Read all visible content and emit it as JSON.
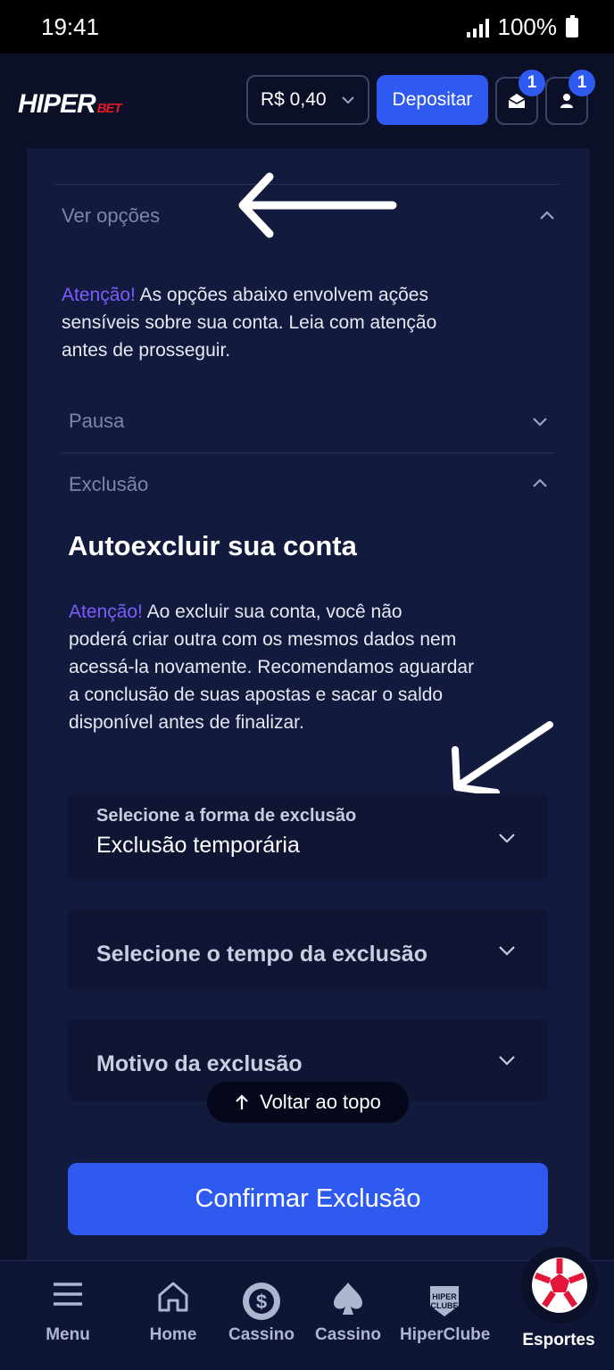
{
  "status_bar": {
    "time": "19:41",
    "battery": "100%"
  },
  "header": {
    "logo_main": "HIPER",
    "logo_sub": "BET",
    "balance": "R$ 0,40",
    "deposit_label": "Depositar",
    "messages_badge": "1",
    "profile_badge": "1"
  },
  "options": {
    "ver_opcoes": "Ver opções",
    "warning_prefix": "Atenção!",
    "warning_lines": [
      "As opções abaixo envolvem ações",
      "sensíveis sobre sua conta. Leia com atenção",
      "antes de prosseguir."
    ],
    "pausa": "Pausa",
    "exclusao": "Exclusão"
  },
  "exclusion": {
    "title": "Autoexcluir sua conta",
    "warning_prefix": "Atenção!",
    "warning_lines": [
      "Ao excluir sua conta, você não",
      "poderá criar outra com os mesmos dados nem",
      "acessá-la novamente. Recomendamos aguardar",
      "a conclusão de suas apostas e sacar o saldo",
      "disponível antes de finalizar."
    ],
    "type_label": "Selecione a forma de exclusão",
    "type_value": "Exclusão temporária",
    "time_placeholder": "Selecione o tempo da exclusão",
    "reason_placeholder": "Motivo da exclusão",
    "back_to_top": "Voltar ao topo",
    "confirm_label": "Confirmar Exclusão"
  },
  "bottom_nav": [
    {
      "label": "Menu",
      "icon": "menu-icon"
    },
    {
      "label": "Home",
      "icon": "home-icon"
    },
    {
      "label": "Cassino",
      "icon": "casino-chip-icon"
    },
    {
      "label": "Cassino",
      "icon": "spade-icon"
    },
    {
      "label": "HiperClube",
      "icon": "hiperclube-icon"
    },
    {
      "label": "Esportes",
      "icon": "soccer-ball-icon"
    }
  ],
  "hiperclube_badge_text": "HIPER CLUBE",
  "colors": {
    "accent": "#2f5af0",
    "attention": "#7c5cff",
    "background": "#0b1028",
    "panel": "#121a3e"
  }
}
